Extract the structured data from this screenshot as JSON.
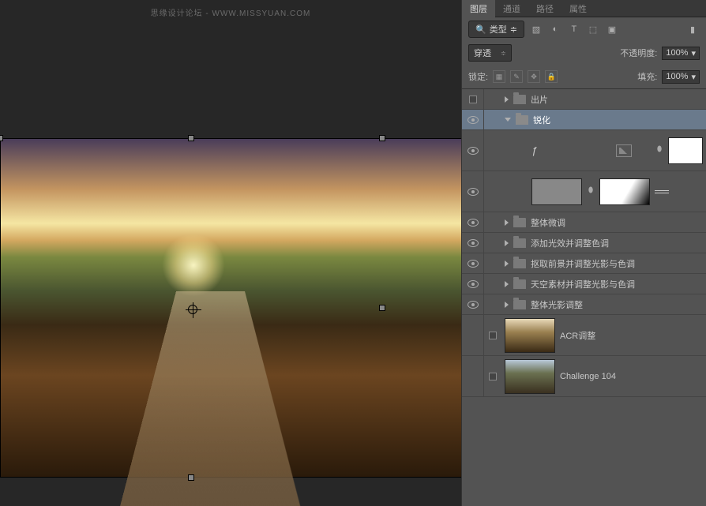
{
  "watermark": "思缘设计论坛 - WWW.MISSYUAN.COM",
  "tabs": {
    "layers": "图层",
    "channels": "通道",
    "paths": "路径",
    "properties": "属性"
  },
  "filter": {
    "label": "类型"
  },
  "blend": {
    "mode": "穿透",
    "opacity_label": "不透明度:",
    "opacity_value": "100%"
  },
  "lock": {
    "label": "锁定:",
    "fill_label": "填充:",
    "fill_value": "100%"
  },
  "layers": {
    "output": "出片",
    "sharpen": "锐化",
    "fine_tune": "整体微调",
    "glow": "添加光效并调整色调",
    "fg": "抠取前景并调整光影与色调",
    "sky": "天空素材并调整光影与色调",
    "overall": "整体光影调整",
    "acr": "ACR调整",
    "challenge": "Challenge 104"
  }
}
